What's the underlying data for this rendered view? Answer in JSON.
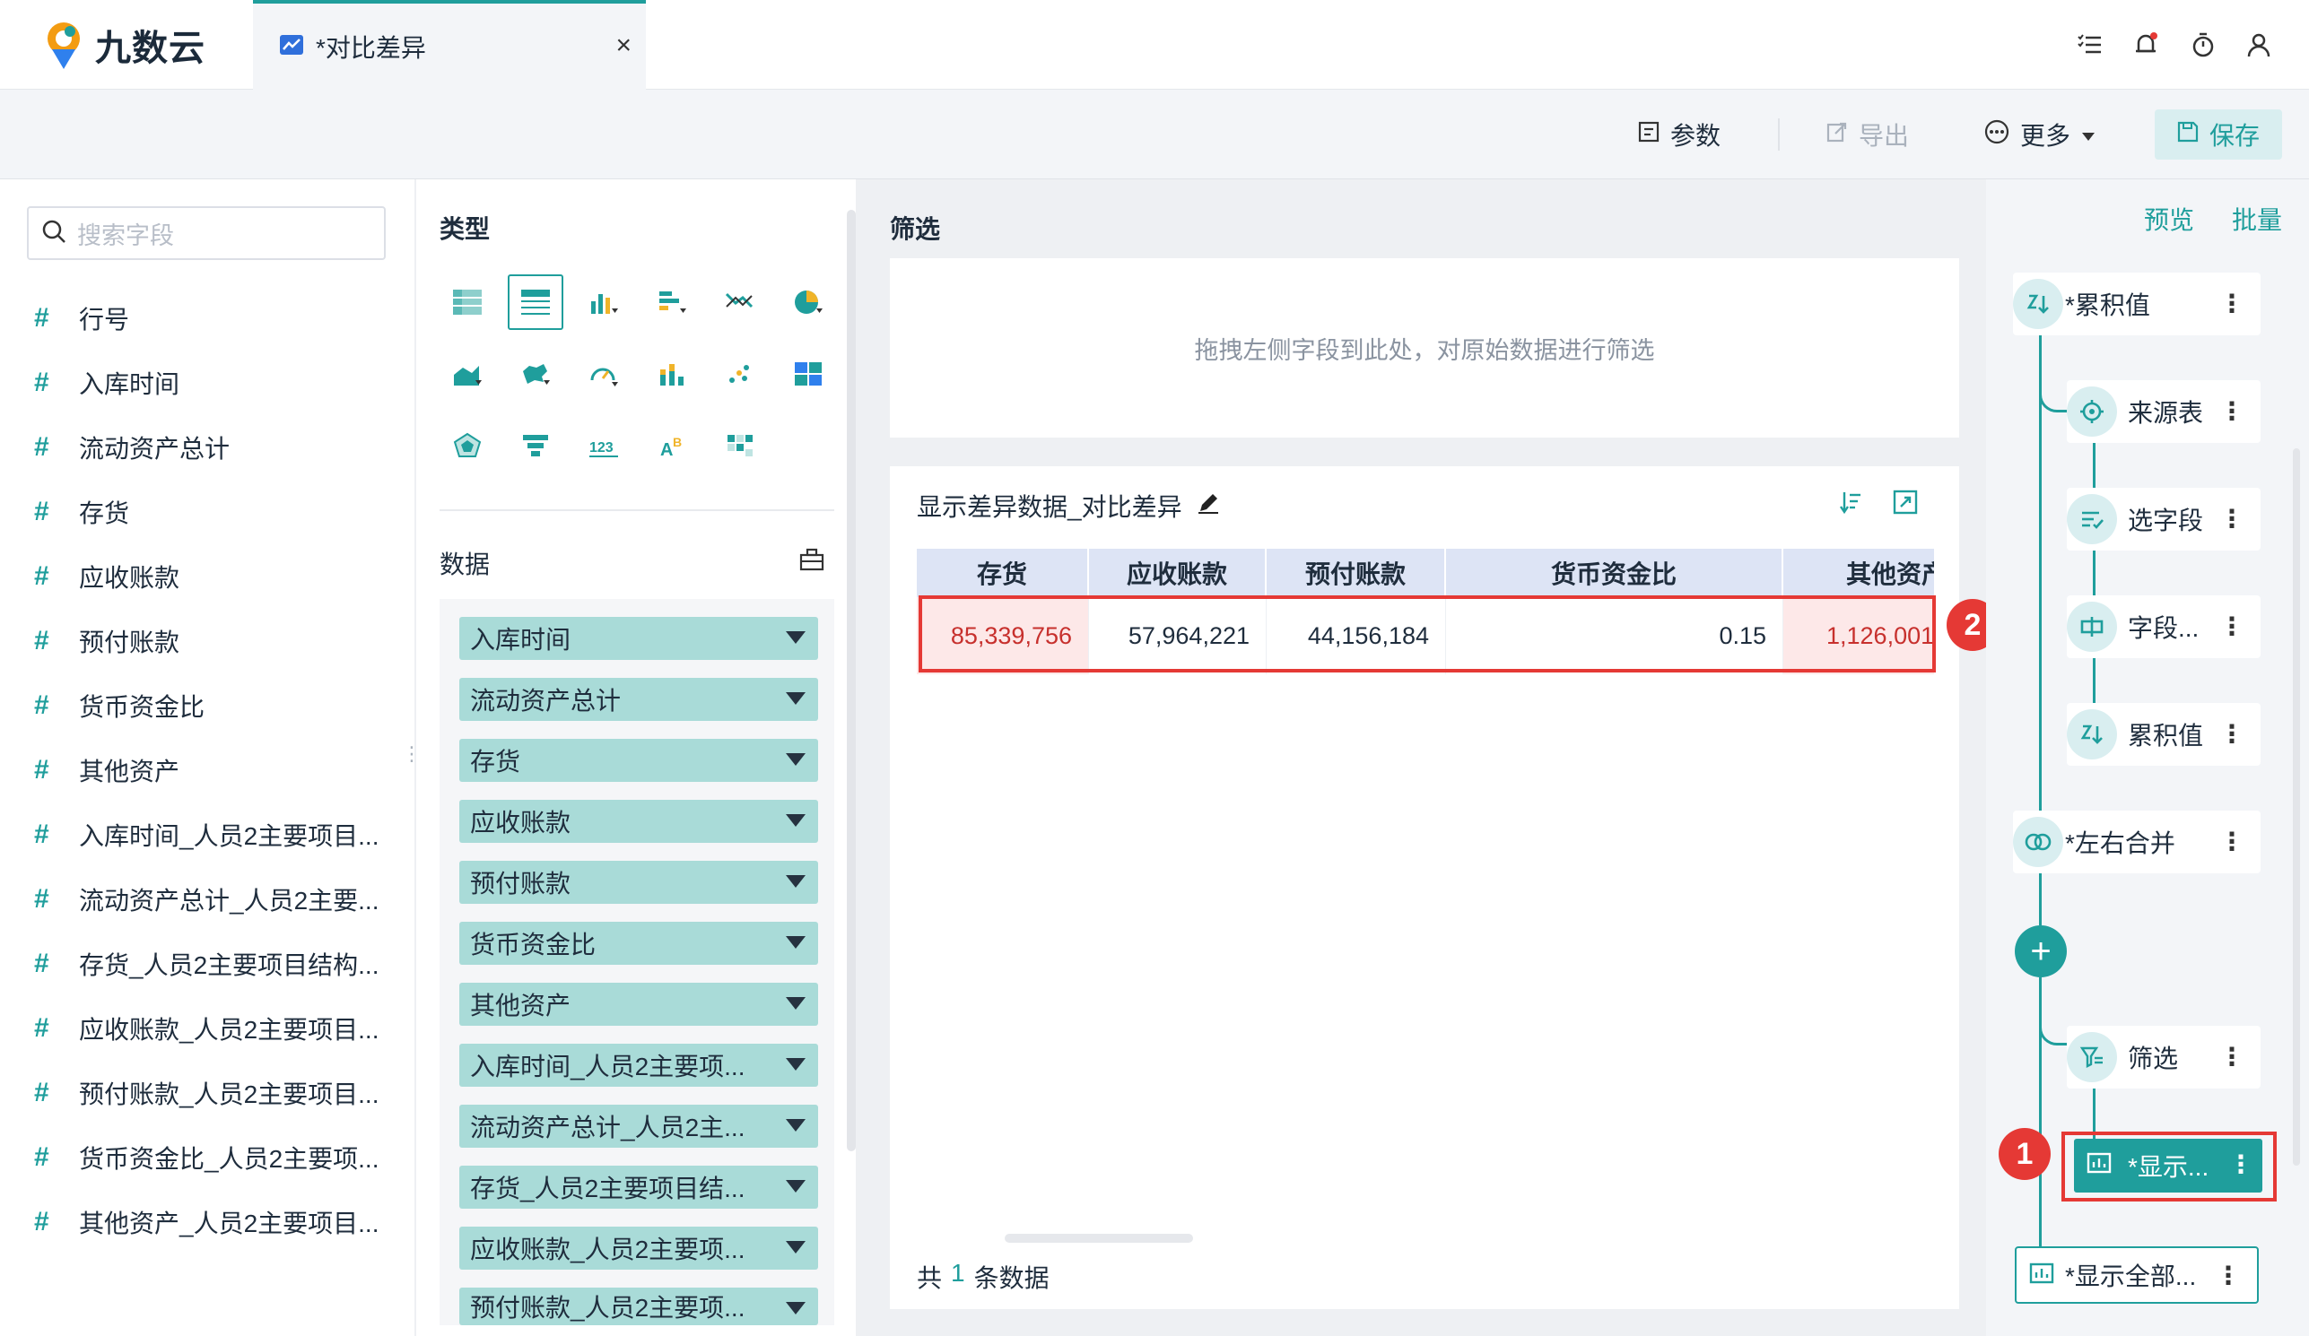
{
  "app": {
    "logo_text": "九数云"
  },
  "tab": {
    "label": "*对比差异",
    "close": "×"
  },
  "toolbar": {
    "params_label": "参数",
    "export_label": "导出",
    "more_label": "更多",
    "save_label": "保存"
  },
  "fields": {
    "search_placeholder": "搜索字段",
    "items": [
      "行号",
      "入库时间",
      "流动资产总计",
      "存货",
      "应收账款",
      "预付账款",
      "货币资金比",
      "其他资产",
      "入库时间_人员2主要项目...",
      "流动资产总计_人员2主要...",
      "存货_人员2主要项目结构...",
      "应收账款_人员2主要项目...",
      "预付账款_人员2主要项目...",
      "货币资金比_人员2主要项...",
      "其他资产_人员2主要项目..."
    ]
  },
  "types": {
    "title": "类型"
  },
  "data_section": {
    "title": "数据",
    "pills": [
      "入库时间",
      "流动资产总计",
      "存货",
      "应收账款",
      "预付账款",
      "货币资金比",
      "其他资产",
      "入库时间_人员2主要项...",
      "流动资产总计_人员2主...",
      "存货_人员2主要项目结...",
      "应收账款_人员2主要项...",
      "预付账款_人员2主要项..."
    ]
  },
  "filter": {
    "title": "筛选",
    "hint": "拖拽左侧字段到此处，对原始数据进行筛选"
  },
  "result": {
    "title": "显示差异数据_对比差异",
    "columns": [
      "存货",
      "应收账款",
      "预付账款",
      "货币资金比",
      "其他资产"
    ],
    "row": [
      "85,339,756",
      "57,964,221",
      "44,156,184",
      "0.15",
      "1,126,001"
    ],
    "footer_prefix": "共",
    "footer_count": "1",
    "footer_suffix": "条数据"
  },
  "flow": {
    "preview": "预览",
    "batch": "批量",
    "nodes": {
      "cumulative_top": "*累积值",
      "source": "来源表",
      "select_fields": "选字段",
      "field_settings": "字段...",
      "cumulative": "累积值",
      "merge": "*左右合并",
      "filter": "筛选",
      "show_active": "*显示...",
      "show_all": "*显示全部..."
    }
  },
  "markers": {
    "one": "1",
    "two": "2"
  },
  "colors": {
    "accent": "#1f9e9c",
    "highlight": "#e53935",
    "pill": "#a9dbd8",
    "diff_cell": "#fde8e8"
  }
}
